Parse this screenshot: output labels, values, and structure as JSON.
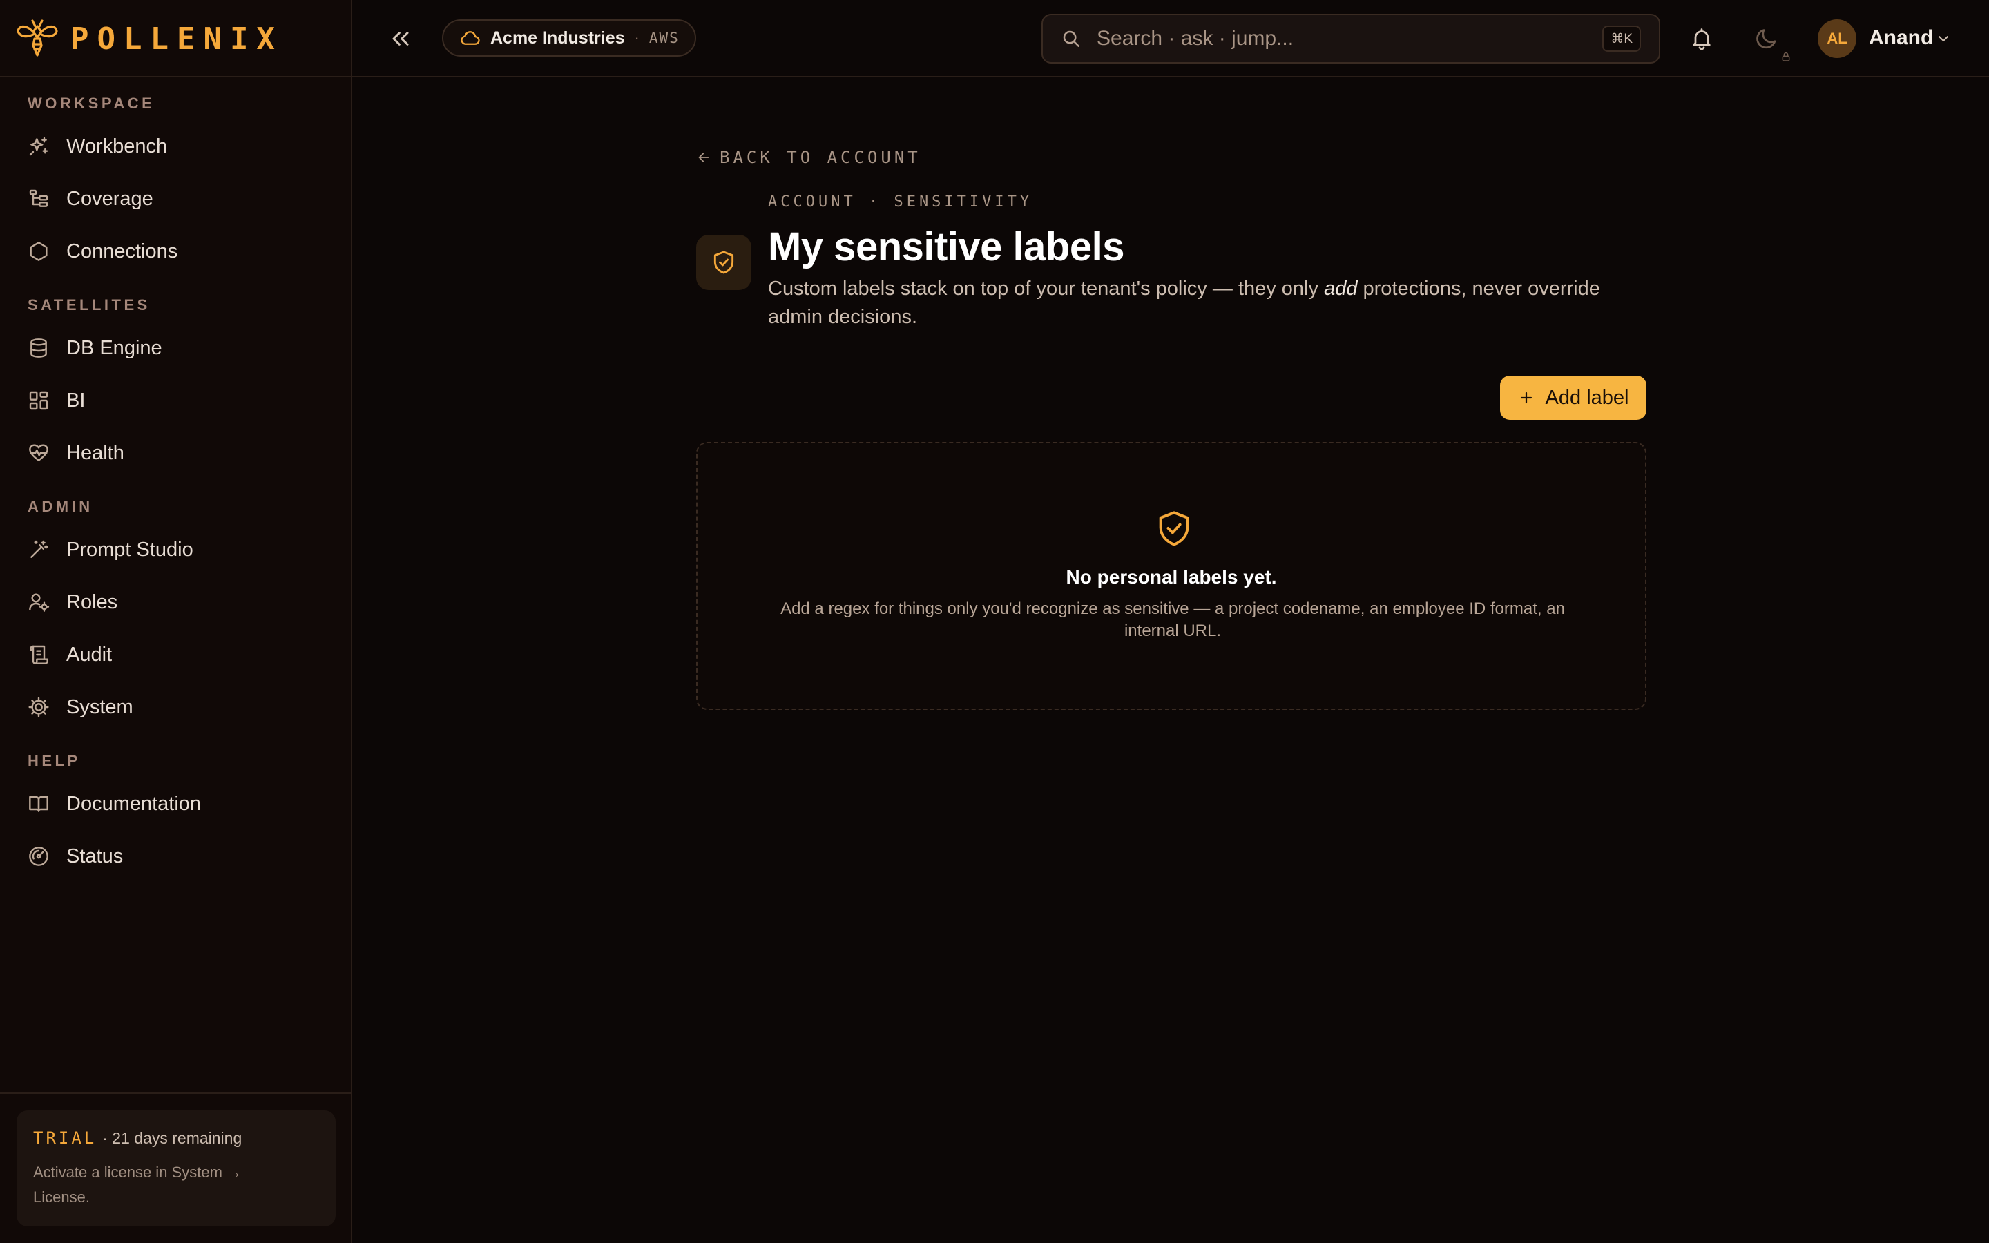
{
  "brand": {
    "name": "POLLENIX",
    "accent": "#f5a83a"
  },
  "sidebar": {
    "sections": [
      {
        "title": "WORKSPACE",
        "items": [
          {
            "label": "Workbench",
            "icon": "sparkles-icon"
          },
          {
            "label": "Coverage",
            "icon": "tree-icon"
          },
          {
            "label": "Connections",
            "icon": "hexagon-icon"
          }
        ]
      },
      {
        "title": "SATELLITES",
        "items": [
          {
            "label": "DB Engine",
            "icon": "database-icon"
          },
          {
            "label": "BI",
            "icon": "dashboard-icon"
          },
          {
            "label": "Health",
            "icon": "heart-pulse-icon"
          }
        ]
      },
      {
        "title": "ADMIN",
        "items": [
          {
            "label": "Prompt Studio",
            "icon": "magic-wand-icon"
          },
          {
            "label": "Roles",
            "icon": "user-cog-icon"
          },
          {
            "label": "Audit",
            "icon": "scroll-icon"
          },
          {
            "label": "System",
            "icon": "cog-icon"
          }
        ]
      },
      {
        "title": "HELP",
        "items": [
          {
            "label": "Documentation",
            "icon": "book-icon"
          },
          {
            "label": "Status",
            "icon": "gauge-icon"
          }
        ]
      }
    ],
    "trial": {
      "tag": "TRIAL",
      "days": "· 21 days remaining",
      "note": "Activate a license in System → License."
    }
  },
  "topbar": {
    "tenant": {
      "name": "Acme Industries",
      "separator": "·",
      "cloud": "AWS"
    },
    "search": {
      "placeholder": "Search · ask · jump...",
      "value": "",
      "shortcut": "⌘K"
    },
    "user": {
      "initials": "AL",
      "name": "Anand"
    }
  },
  "main": {
    "back_label": "BACK TO ACCOUNT",
    "eyebrow": "ACCOUNT · SENSITIVITY",
    "title": "My sensitive labels",
    "description": {
      "before": "Custom labels stack on top of your tenant's policy — they only ",
      "emphasis": "add",
      "after": " protections, never override admin decisions."
    },
    "add_button": "Add label",
    "empty": {
      "title": "No personal labels yet.",
      "description": "Add a regex for things only you'd recognize as sensitive — a project codename, an employee ID format, an internal URL."
    }
  }
}
